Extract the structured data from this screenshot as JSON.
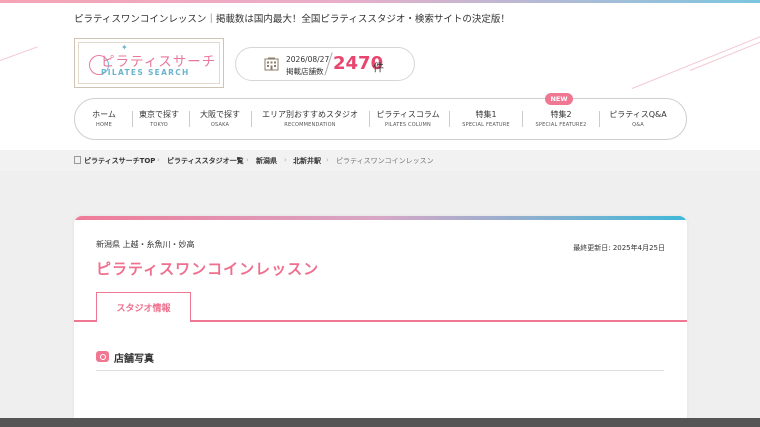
{
  "header": {
    "tagline": "ピラティスワンコインレッスン｜掲載数は国内最大！全国ピラティススタジオ・検索サイトの決定版！",
    "logo": {
      "jp": "ピラティスサーチ",
      "en": "PILATES SEARCH"
    },
    "count": {
      "date": "2026/08/27",
      "label": "掲載店舗数",
      "number": "2470",
      "unit": "件"
    }
  },
  "nav": {
    "items": [
      {
        "jp": "ホーム",
        "en": "HOME"
      },
      {
        "jp": "東京で探す",
        "en": "TOKYO"
      },
      {
        "jp": "大阪で探す",
        "en": "OSAKA"
      },
      {
        "jp": "エリア別おすすめスタジオ",
        "en": "RECOMMENDATION"
      },
      {
        "jp": "ピラティスコラム",
        "en": "PILATES COLUMN"
      },
      {
        "jp": "特集1",
        "en": "SPECIAL FEATURE"
      },
      {
        "jp": "特集2",
        "en": "SPECIAL FEATURE2"
      },
      {
        "jp": "ピラティスQ&A",
        "en": "Q&A"
      }
    ],
    "new_badge": "NEW"
  },
  "breadcrumb": [
    "ピラティスサーチTOP",
    "ピラティススタジオ一覧",
    "新潟県",
    "北新井駅",
    "ピラティスワンコインレッスン"
  ],
  "studio": {
    "area": "新潟県 上越・糸魚川・妙高",
    "updated": "最終更新日: 2025年4月25日",
    "name": "ピラティスワンコインレッスン",
    "tab_active": "スタジオ情報",
    "section_title": "店舗写真"
  },
  "colors": {
    "accent": "#f07792",
    "brand_pink": "#ee6f8e",
    "brand_blue": "#40b8d8"
  }
}
